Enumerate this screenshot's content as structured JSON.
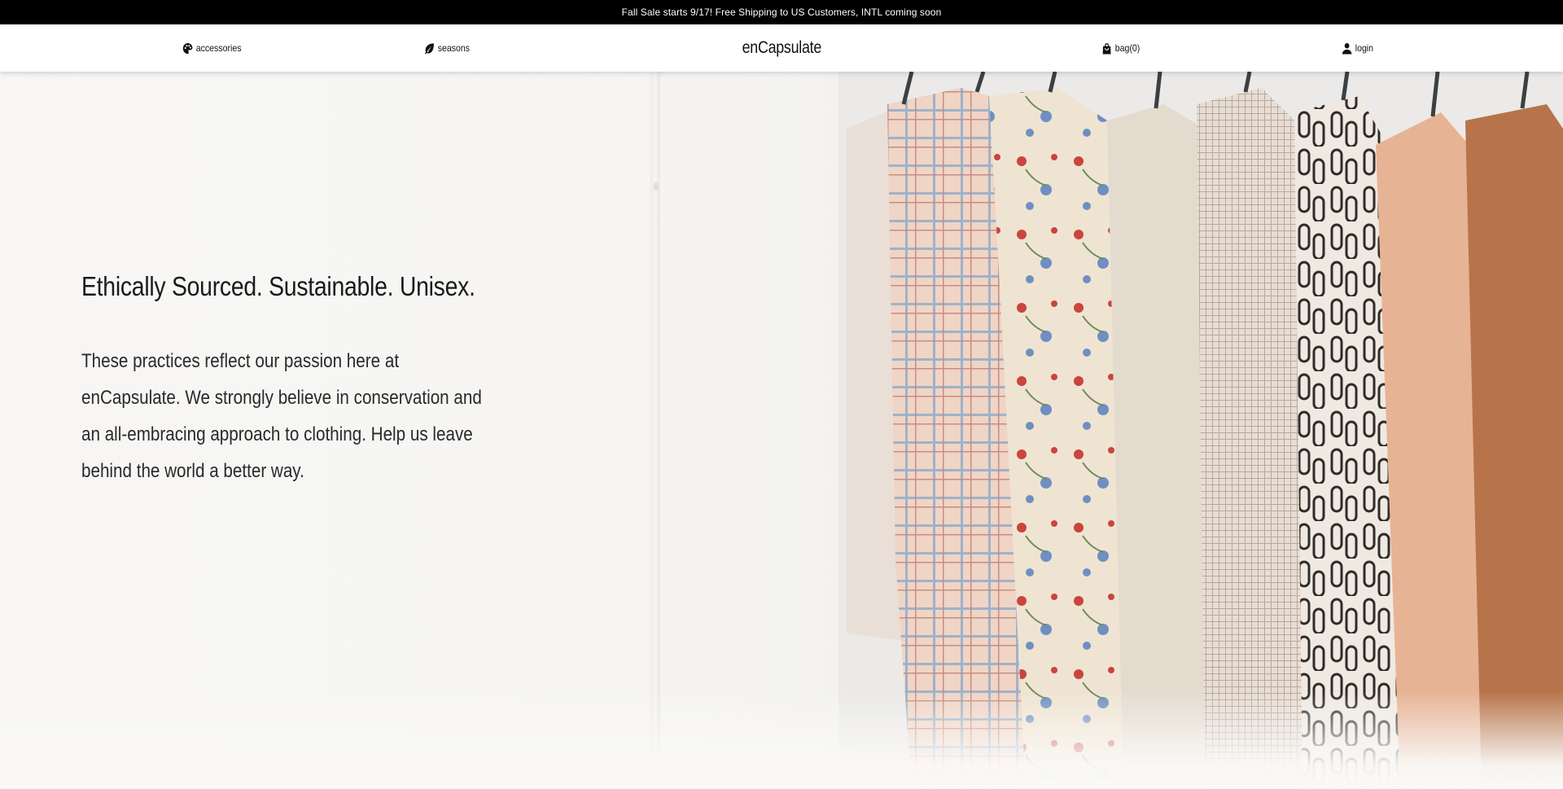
{
  "announcement": {
    "text": "Fall Sale starts 9/17! Free Shipping to US Customers, INTL coming soon"
  },
  "nav": {
    "accessories": {
      "label": "accessories",
      "icon": "palette-icon"
    },
    "seasons": {
      "label": "seasons",
      "icon": "leaf-icon"
    },
    "brand": "enCapsulate",
    "bag": {
      "label": "bag(0)",
      "icon": "shopping-bag-icon"
    },
    "login": {
      "label": "login",
      "icon": "user-icon"
    }
  },
  "hero": {
    "headline": "Ethically Sourced. Sustainable. Unisex.",
    "body": "These practices reflect our passion here at enCapsulate. We strongly believe in conservation and an all-embracing approach to clothing. Help us leave behind the world a better way.",
    "image": "clothing-rack-photo"
  },
  "colors": {
    "announcement_bg": "#000000",
    "nav_bg": "#ffffff",
    "hero_bg": "#f7f6f4",
    "text": "#111111"
  }
}
